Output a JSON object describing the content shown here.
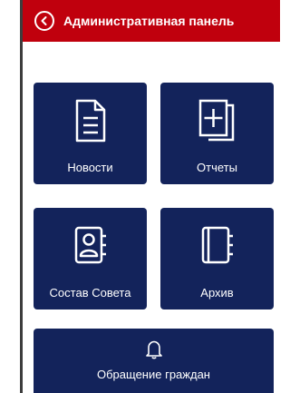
{
  "header": {
    "title": "Административная панель",
    "back_icon": "chevron-left-circle-icon",
    "background": "#c0000d"
  },
  "tiles": [
    {
      "label": "Новости",
      "icon": "document-icon"
    },
    {
      "label": "Отчеты",
      "icon": "add-document-icon"
    },
    {
      "label": "Состав Совета",
      "icon": "contacts-book-icon"
    },
    {
      "label": "Архив",
      "icon": "notebook-icon"
    },
    {
      "label": "Обращение граждан",
      "icon": "bell-icon"
    }
  ],
  "colors": {
    "tile": "#13235b",
    "accent": "#c0000d"
  }
}
